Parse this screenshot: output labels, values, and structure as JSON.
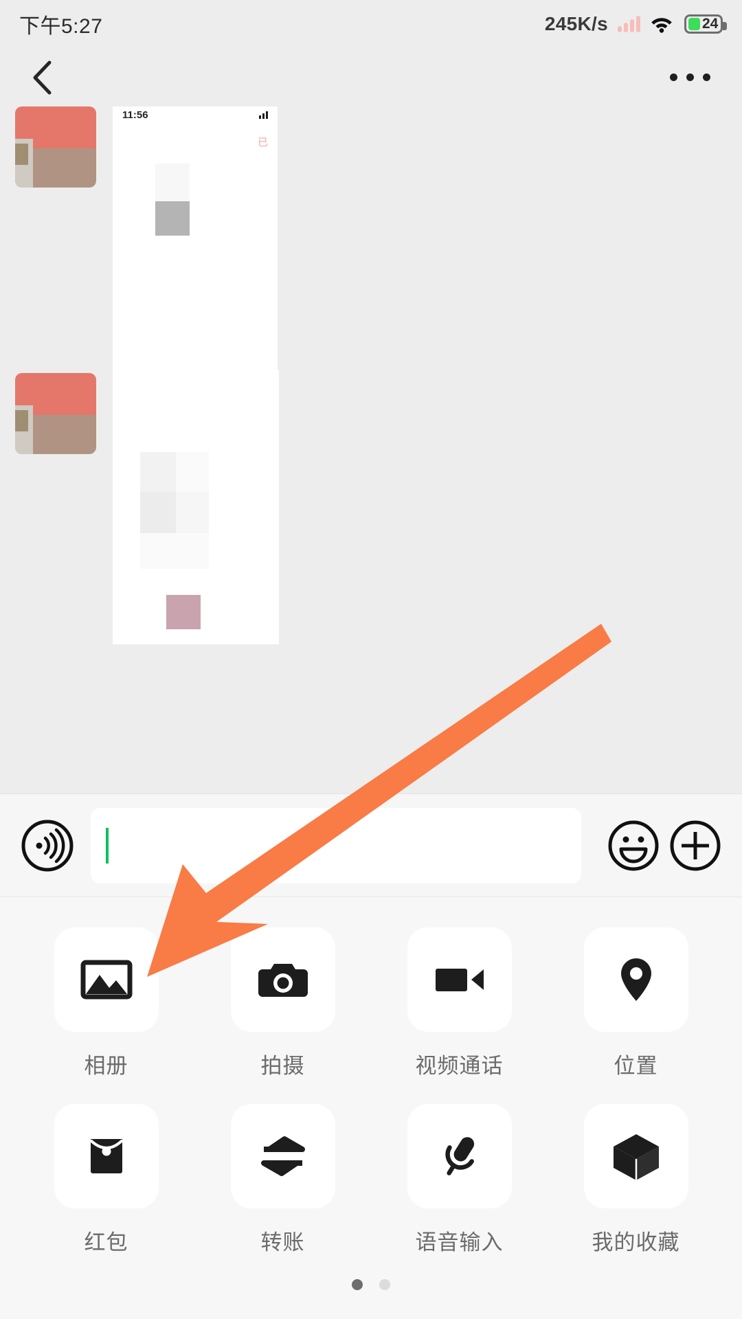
{
  "status_bar": {
    "time": "下午5:27",
    "network_speed": "245K/s",
    "battery_level": "24",
    "signal_icon": "signal-bars-icon",
    "wifi_icon": "wifi-icon",
    "battery_icon": "battery-icon",
    "accent_signal_color": "#f6bdb9",
    "battery_fill_color": "#3ddc5b"
  },
  "nav_bar": {
    "back_icon": "back-chevron-icon",
    "title": "",
    "more_icon": "more-options-icon"
  },
  "chat": {
    "messages": [
      {
        "sender_avatar": "contact-avatar",
        "attachment_type": "screenshot-image",
        "screenshot_time": "11:56",
        "screenshot_badge": "已"
      },
      {
        "sender_avatar": "contact-avatar",
        "attachment_type": "screenshot-image"
      }
    ]
  },
  "input_bar": {
    "voice_icon": "voice-input-icon",
    "input_value": "",
    "input_placeholder": "",
    "emoji_icon": "emoji-smiley-icon",
    "more_icon": "plus-circle-icon",
    "caret_color": "#07c160"
  },
  "panel": {
    "items": [
      {
        "label": "相册",
        "icon": "photo-album-icon"
      },
      {
        "label": "拍摄",
        "icon": "camera-icon"
      },
      {
        "label": "视频通话",
        "icon": "video-call-icon"
      },
      {
        "label": "位置",
        "icon": "location-pin-icon"
      },
      {
        "label": "红包",
        "icon": "red-packet-icon"
      },
      {
        "label": "转账",
        "icon": "transfer-icon"
      },
      {
        "label": "语音输入",
        "icon": "microphone-icon"
      },
      {
        "label": "我的收藏",
        "icon": "favorites-cube-icon"
      }
    ],
    "page_current": 1,
    "page_total": 2
  },
  "annotation": {
    "arrow_color": "#f97b45",
    "arrow_target": "相册"
  }
}
